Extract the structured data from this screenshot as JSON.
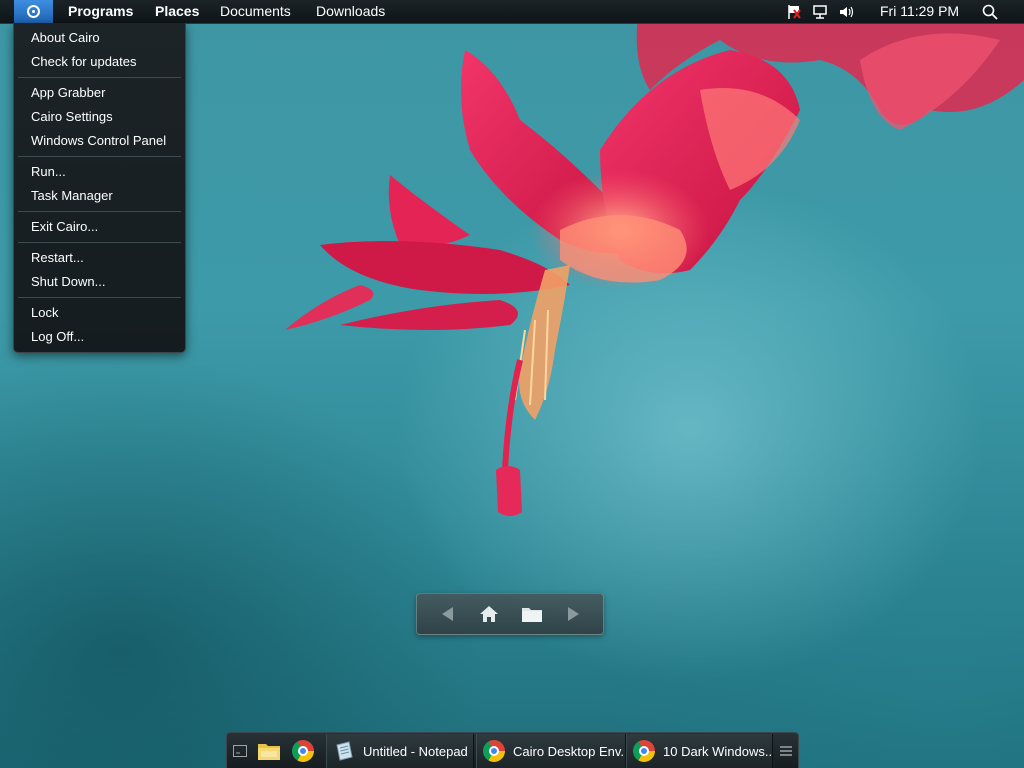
{
  "menubar": {
    "programs": "Programs",
    "places": "Places",
    "documents": "Documents",
    "downloads": "Downloads",
    "clock": "Fri 11:29 PM",
    "tray_icons": [
      "action-center-flag-icon",
      "network-icon",
      "volume-icon"
    ],
    "search_icon": "search-icon"
  },
  "cairo_menu": {
    "groups": [
      [
        "About Cairo",
        "Check for updates"
      ],
      [
        "App Grabber",
        "Cairo Settings",
        "Windows Control Panel"
      ],
      [
        "Run...",
        "Task Manager"
      ],
      [
        "Exit Cairo..."
      ],
      [
        "Restart...",
        "Shut Down..."
      ],
      [
        "Lock",
        "Log Off..."
      ]
    ]
  },
  "nav_widget": {
    "icons": [
      "back-arrow-icon",
      "home-icon",
      "folder-icon",
      "forward-arrow-icon"
    ]
  },
  "taskbar": {
    "quick_launch": [
      "show-desktop-icon",
      "file-explorer-icon",
      "chrome-icon"
    ],
    "tasks": [
      {
        "label": "Untitled - Notepad",
        "icon": "notepad-icon"
      },
      {
        "label": "Cairo Desktop Env...",
        "icon": "chrome-icon"
      },
      {
        "label": "10 Dark Windows...",
        "icon": "chrome-icon"
      }
    ],
    "menu_icon": "hamburger-menu-icon"
  },
  "colors": {
    "accent": "#2a78cf",
    "menubar_bg": "#131a1d",
    "wallpaper": "#3d98a6",
    "flower": "#e8264e"
  }
}
